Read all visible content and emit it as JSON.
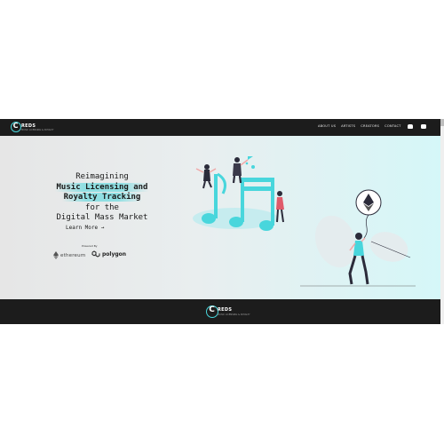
{
  "nav": {
    "logo_text": "REDS",
    "logo_sub": "MUSIC LICENSING & ROYALTY",
    "links": [
      "ABOUT US",
      "ARTISTS",
      "CREATORS",
      "CONTACT"
    ],
    "icons": [
      "discord-icon",
      "youtube-icon"
    ]
  },
  "hero": {
    "line1": "Reimagining",
    "line2": "Music Licensing and",
    "line3": "Royalty Tracking",
    "line4": "for the",
    "line5": "Digital Mass Market",
    "cta": "Learn More →",
    "powered_by": "Powered By",
    "partners": [
      "ethereum",
      "polygon"
    ]
  },
  "footer": {
    "logo_text": "REDS",
    "logo_sub": "MUSIC LICENSING & ROYALTY"
  },
  "colors": {
    "nav_bg": "#1c1c1c",
    "accent": "#48d6dc",
    "hero_left": "#e6e6e6",
    "hero_right": "#d5f7f8"
  }
}
